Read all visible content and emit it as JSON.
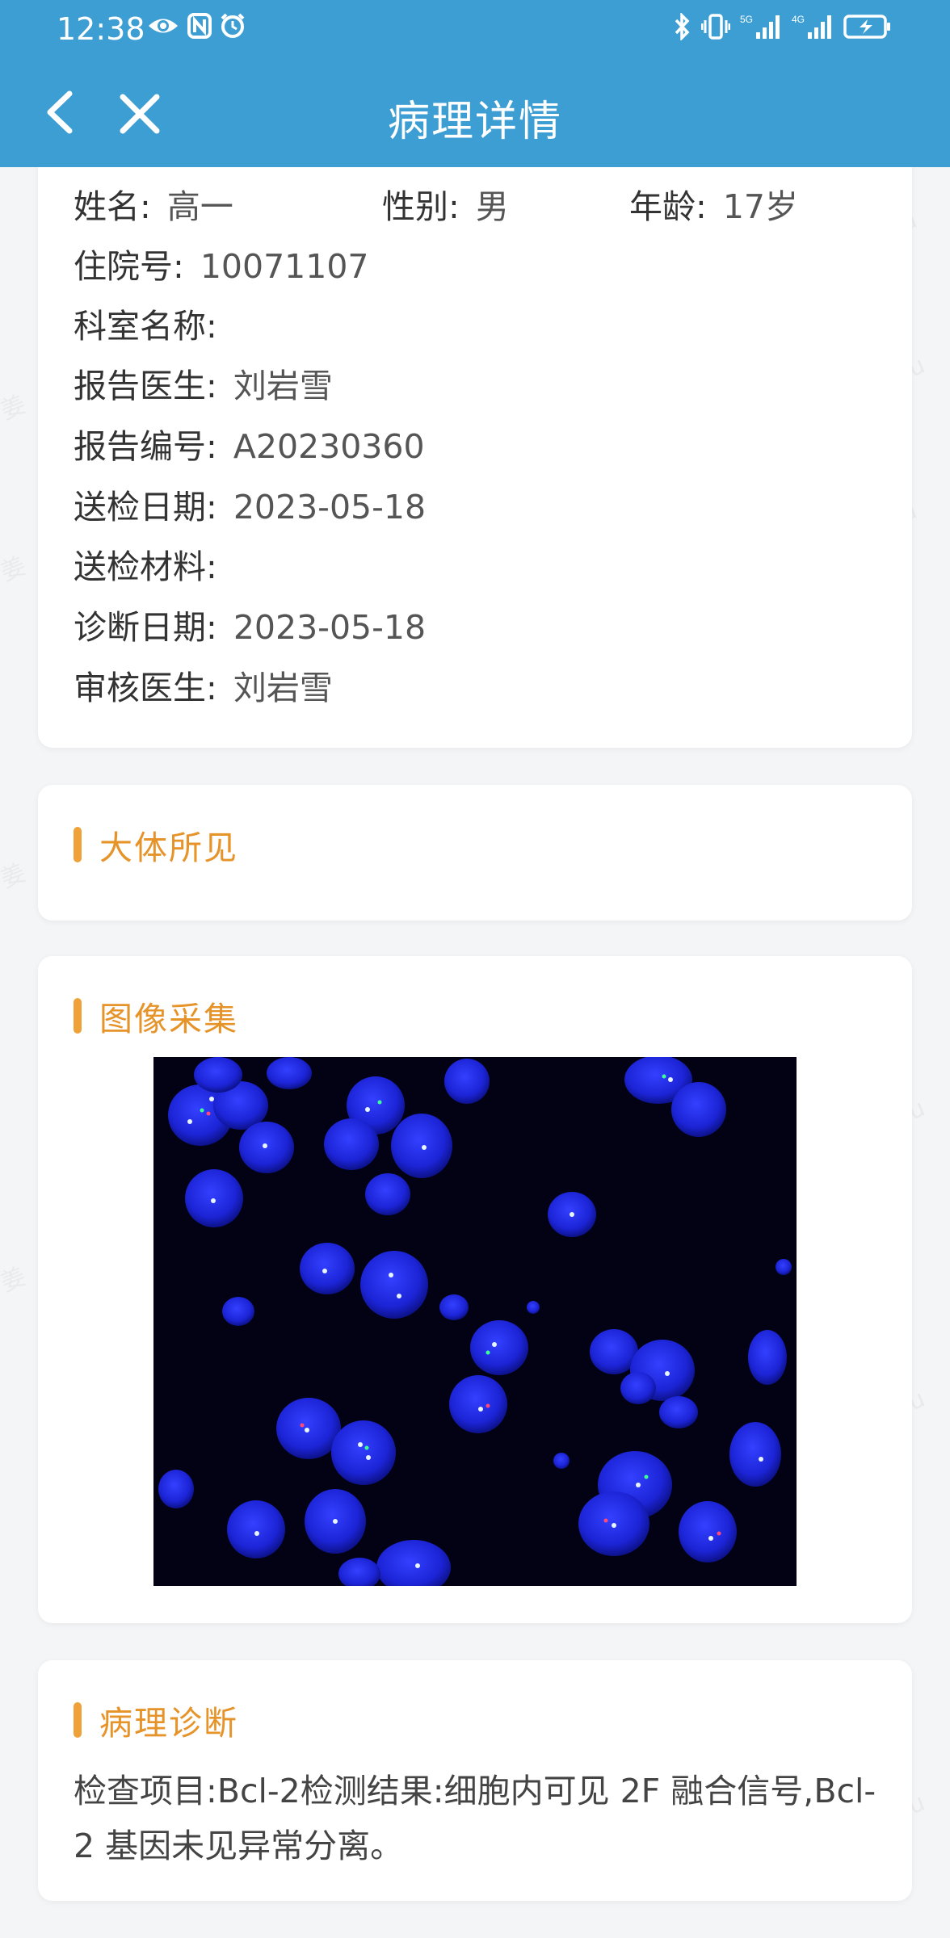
{
  "status_bar": {
    "time": "12:38",
    "left_icons": [
      "eye-icon",
      "nfc-icon",
      "alarm-icon"
    ],
    "right_icons": [
      "bluetooth-icon",
      "vibrate-icon",
      "signal-5g-icon",
      "signal-4g-icon",
      "battery-charging-icon"
    ],
    "signal_5g_label": "5G",
    "signal_4g_label": "4G"
  },
  "nav": {
    "title": "病理详情",
    "back_icon": "chevron-left-icon",
    "close_icon": "close-icon"
  },
  "patient": {
    "name_label": "姓名:",
    "name": "高一",
    "gender_label": "性别:",
    "gender": "男",
    "age_label": "年龄:",
    "age": "17岁",
    "admission_no_label": "住院号:",
    "admission_no": "10071107",
    "department_label": "科室名称:",
    "department": "",
    "report_doctor_label": "报告医生:",
    "report_doctor": "刘岩雪",
    "report_no_label": "报告编号:",
    "report_no": "A20230360",
    "submit_date_label": "送检日期:",
    "submit_date": "2023-05-18",
    "material_label": "送检材料:",
    "material": "",
    "diagnosis_date_label": "诊断日期:",
    "diagnosis_date": "2023-05-18",
    "review_doctor_label": "审核医生:",
    "review_doctor": "刘岩雪"
  },
  "sections": {
    "gross_title": "大体所见",
    "image_title": "图像采集",
    "diagnosis_title": "病理诊断",
    "diagnosis_text": "检查项目:Bcl-2检测结果:细胞内可见 2F 融合信号,Bcl-2 基因未见异常分离。"
  },
  "colors": {
    "header": "#3d9ed3",
    "accent": "#f0a23a",
    "section_title": "#e6932a",
    "nucleus": "#1c24d6"
  }
}
